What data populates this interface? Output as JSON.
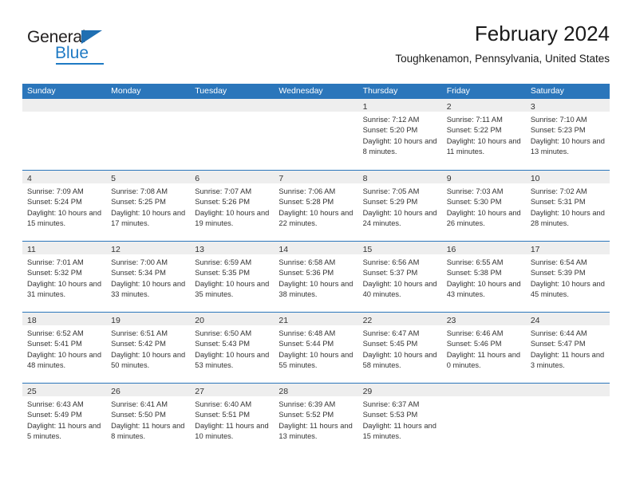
{
  "brand": {
    "name_part1": "General",
    "name_part2": "Blue"
  },
  "header": {
    "title": "February 2024",
    "subtitle": "Toughkenamon, Pennsylvania, United States"
  },
  "labels": {
    "sunrise_prefix": "Sunrise: ",
    "sunset_prefix": "Sunset: ",
    "daylight_prefix": "Daylight: "
  },
  "colors": {
    "header_blue": "#2b76bb",
    "brand_blue": "#1f7ac4",
    "day_band_gray": "#eeeeee",
    "text_dark": "#333333"
  },
  "weekdays": [
    "Sunday",
    "Monday",
    "Tuesday",
    "Wednesday",
    "Thursday",
    "Friday",
    "Saturday"
  ],
  "weeks": [
    [
      {
        "day": "",
        "sunrise": "",
        "sunset": "",
        "daylight": ""
      },
      {
        "day": "",
        "sunrise": "",
        "sunset": "",
        "daylight": ""
      },
      {
        "day": "",
        "sunrise": "",
        "sunset": "",
        "daylight": ""
      },
      {
        "day": "",
        "sunrise": "",
        "sunset": "",
        "daylight": ""
      },
      {
        "day": "1",
        "sunrise": "Sunrise: 7:12 AM",
        "sunset": "Sunset: 5:20 PM",
        "daylight": "Daylight: 10 hours and 8 minutes."
      },
      {
        "day": "2",
        "sunrise": "Sunrise: 7:11 AM",
        "sunset": "Sunset: 5:22 PM",
        "daylight": "Daylight: 10 hours and 11 minutes."
      },
      {
        "day": "3",
        "sunrise": "Sunrise: 7:10 AM",
        "sunset": "Sunset: 5:23 PM",
        "daylight": "Daylight: 10 hours and 13 minutes."
      }
    ],
    [
      {
        "day": "4",
        "sunrise": "Sunrise: 7:09 AM",
        "sunset": "Sunset: 5:24 PM",
        "daylight": "Daylight: 10 hours and 15 minutes."
      },
      {
        "day": "5",
        "sunrise": "Sunrise: 7:08 AM",
        "sunset": "Sunset: 5:25 PM",
        "daylight": "Daylight: 10 hours and 17 minutes."
      },
      {
        "day": "6",
        "sunrise": "Sunrise: 7:07 AM",
        "sunset": "Sunset: 5:26 PM",
        "daylight": "Daylight: 10 hours and 19 minutes."
      },
      {
        "day": "7",
        "sunrise": "Sunrise: 7:06 AM",
        "sunset": "Sunset: 5:28 PM",
        "daylight": "Daylight: 10 hours and 22 minutes."
      },
      {
        "day": "8",
        "sunrise": "Sunrise: 7:05 AM",
        "sunset": "Sunset: 5:29 PM",
        "daylight": "Daylight: 10 hours and 24 minutes."
      },
      {
        "day": "9",
        "sunrise": "Sunrise: 7:03 AM",
        "sunset": "Sunset: 5:30 PM",
        "daylight": "Daylight: 10 hours and 26 minutes."
      },
      {
        "day": "10",
        "sunrise": "Sunrise: 7:02 AM",
        "sunset": "Sunset: 5:31 PM",
        "daylight": "Daylight: 10 hours and 28 minutes."
      }
    ],
    [
      {
        "day": "11",
        "sunrise": "Sunrise: 7:01 AM",
        "sunset": "Sunset: 5:32 PM",
        "daylight": "Daylight: 10 hours and 31 minutes."
      },
      {
        "day": "12",
        "sunrise": "Sunrise: 7:00 AM",
        "sunset": "Sunset: 5:34 PM",
        "daylight": "Daylight: 10 hours and 33 minutes."
      },
      {
        "day": "13",
        "sunrise": "Sunrise: 6:59 AM",
        "sunset": "Sunset: 5:35 PM",
        "daylight": "Daylight: 10 hours and 35 minutes."
      },
      {
        "day": "14",
        "sunrise": "Sunrise: 6:58 AM",
        "sunset": "Sunset: 5:36 PM",
        "daylight": "Daylight: 10 hours and 38 minutes."
      },
      {
        "day": "15",
        "sunrise": "Sunrise: 6:56 AM",
        "sunset": "Sunset: 5:37 PM",
        "daylight": "Daylight: 10 hours and 40 minutes."
      },
      {
        "day": "16",
        "sunrise": "Sunrise: 6:55 AM",
        "sunset": "Sunset: 5:38 PM",
        "daylight": "Daylight: 10 hours and 43 minutes."
      },
      {
        "day": "17",
        "sunrise": "Sunrise: 6:54 AM",
        "sunset": "Sunset: 5:39 PM",
        "daylight": "Daylight: 10 hours and 45 minutes."
      }
    ],
    [
      {
        "day": "18",
        "sunrise": "Sunrise: 6:52 AM",
        "sunset": "Sunset: 5:41 PM",
        "daylight": "Daylight: 10 hours and 48 minutes."
      },
      {
        "day": "19",
        "sunrise": "Sunrise: 6:51 AM",
        "sunset": "Sunset: 5:42 PM",
        "daylight": "Daylight: 10 hours and 50 minutes."
      },
      {
        "day": "20",
        "sunrise": "Sunrise: 6:50 AM",
        "sunset": "Sunset: 5:43 PM",
        "daylight": "Daylight: 10 hours and 53 minutes."
      },
      {
        "day": "21",
        "sunrise": "Sunrise: 6:48 AM",
        "sunset": "Sunset: 5:44 PM",
        "daylight": "Daylight: 10 hours and 55 minutes."
      },
      {
        "day": "22",
        "sunrise": "Sunrise: 6:47 AM",
        "sunset": "Sunset: 5:45 PM",
        "daylight": "Daylight: 10 hours and 58 minutes."
      },
      {
        "day": "23",
        "sunrise": "Sunrise: 6:46 AM",
        "sunset": "Sunset: 5:46 PM",
        "daylight": "Daylight: 11 hours and 0 minutes."
      },
      {
        "day": "24",
        "sunrise": "Sunrise: 6:44 AM",
        "sunset": "Sunset: 5:47 PM",
        "daylight": "Daylight: 11 hours and 3 minutes."
      }
    ],
    [
      {
        "day": "25",
        "sunrise": "Sunrise: 6:43 AM",
        "sunset": "Sunset: 5:49 PM",
        "daylight": "Daylight: 11 hours and 5 minutes."
      },
      {
        "day": "26",
        "sunrise": "Sunrise: 6:41 AM",
        "sunset": "Sunset: 5:50 PM",
        "daylight": "Daylight: 11 hours and 8 minutes."
      },
      {
        "day": "27",
        "sunrise": "Sunrise: 6:40 AM",
        "sunset": "Sunset: 5:51 PM",
        "daylight": "Daylight: 11 hours and 10 minutes."
      },
      {
        "day": "28",
        "sunrise": "Sunrise: 6:39 AM",
        "sunset": "Sunset: 5:52 PM",
        "daylight": "Daylight: 11 hours and 13 minutes."
      },
      {
        "day": "29",
        "sunrise": "Sunrise: 6:37 AM",
        "sunset": "Sunset: 5:53 PM",
        "daylight": "Daylight: 11 hours and 15 minutes."
      },
      {
        "day": "",
        "sunrise": "",
        "sunset": "",
        "daylight": ""
      },
      {
        "day": "",
        "sunrise": "",
        "sunset": "",
        "daylight": ""
      }
    ]
  ]
}
